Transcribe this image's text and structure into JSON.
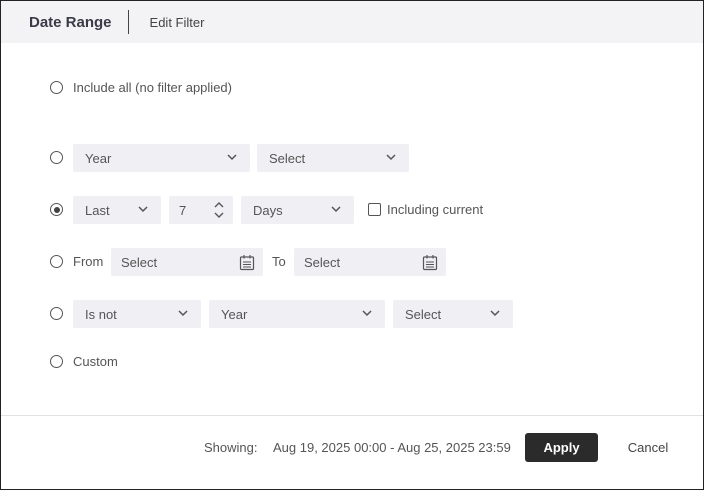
{
  "header": {
    "title": "Date Range",
    "subtitle": "Edit Filter"
  },
  "options": {
    "include_all": {
      "label": "Include all (no filter applied)",
      "selected": false
    },
    "year_row": {
      "selected": false,
      "period": "Year",
      "value": "Select"
    },
    "last_row": {
      "selected": true,
      "mode": "Last",
      "count": "7",
      "unit": "Days",
      "including_current_label": "Including current",
      "including_current_checked": false
    },
    "range_row": {
      "selected": false,
      "from_label": "From",
      "from_placeholder": "Select",
      "to_label": "To",
      "to_placeholder": "Select"
    },
    "is_not_row": {
      "selected": false,
      "operator": "Is not",
      "period": "Year",
      "value": "Select"
    },
    "custom": {
      "label": "Custom",
      "selected": false
    }
  },
  "footer": {
    "showing_label": "Showing:",
    "showing_value": "Aug 19, 2025 00:00 - Aug 25, 2025 23:59",
    "apply_label": "Apply",
    "cancel_label": "Cancel"
  },
  "icons": {
    "dropdown": "chevron-down-icon",
    "spinner": "up-down-chevron-icon",
    "calendar": "calendar-icon"
  },
  "colors": {
    "apply_bg": "#2b2b2b",
    "header_bg": "#f3f3f6",
    "field_bg": "#f0f0f4"
  }
}
